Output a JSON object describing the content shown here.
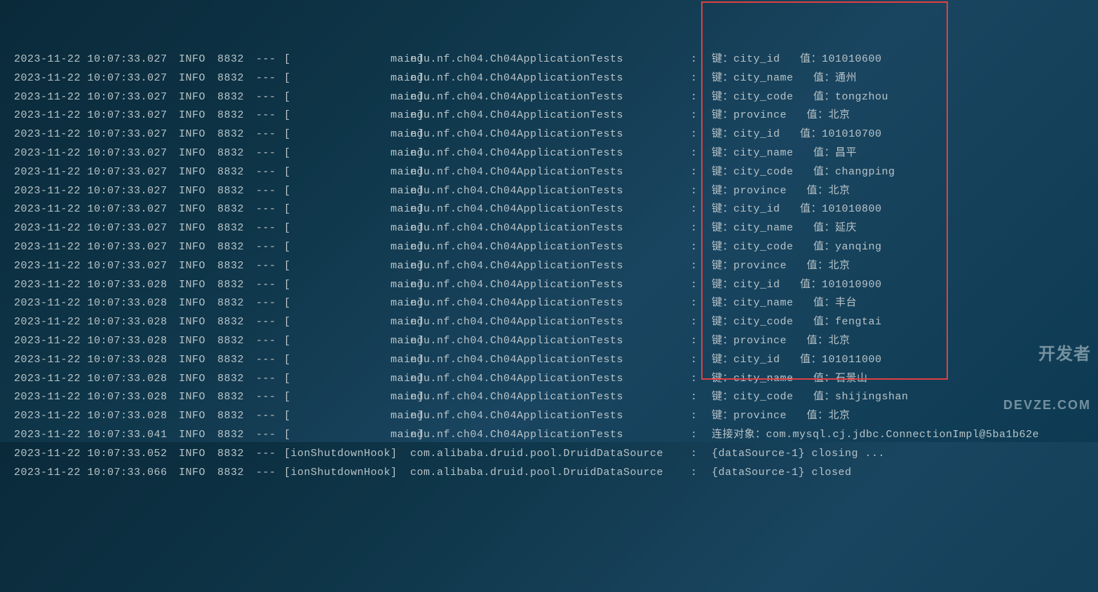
{
  "watermark": {
    "line1": "开发者",
    "line2": "DEVZE.COM"
  },
  "common": {
    "level": "INFO",
    "pid": "8832",
    "dashes": "---",
    "thread_main_fmt": "[               main]",
    "thread_shutdown_fmt": "[ionShutdownHook]",
    "logger_app": "edu.nf.ch04.Ch04ApplicationTests",
    "logger_druid": "com.alibaba.druid.pool.DruidDataSource",
    "colon": ":"
  },
  "lines": [
    {
      "ts": "2023-11-22 10:07:33.027",
      "thread": "main",
      "logger": "app",
      "msg": "键：city_id   值：101010600"
    },
    {
      "ts": "2023-11-22 10:07:33.027",
      "thread": "main",
      "logger": "app",
      "msg": "键：city_name   值：通州"
    },
    {
      "ts": "2023-11-22 10:07:33.027",
      "thread": "main",
      "logger": "app",
      "msg": "键：city_code   值：tongzhou"
    },
    {
      "ts": "2023-11-22 10:07:33.027",
      "thread": "main",
      "logger": "app",
      "msg": "键：province   值：北京"
    },
    {
      "ts": "2023-11-22 10:07:33.027",
      "thread": "main",
      "logger": "app",
      "msg": "键：city_id   值：101010700"
    },
    {
      "ts": "2023-11-22 10:07:33.027",
      "thread": "main",
      "logger": "app",
      "msg": "键：city_name   值：昌平"
    },
    {
      "ts": "2023-11-22 10:07:33.027",
      "thread": "main",
      "logger": "app",
      "msg": "键：city_code   值：changping"
    },
    {
      "ts": "2023-11-22 10:07:33.027",
      "thread": "main",
      "logger": "app",
      "msg": "键：province   值：北京"
    },
    {
      "ts": "2023-11-22 10:07:33.027",
      "thread": "main",
      "logger": "app",
      "msg": "键：city_id   值：101010800"
    },
    {
      "ts": "2023-11-22 10:07:33.027",
      "thread": "main",
      "logger": "app",
      "msg": "键：city_name   值：延庆"
    },
    {
      "ts": "2023-11-22 10:07:33.027",
      "thread": "main",
      "logger": "app",
      "msg": "键：city_code   值：yanqing"
    },
    {
      "ts": "2023-11-22 10:07:33.027",
      "thread": "main",
      "logger": "app",
      "msg": "键：province   值：北京"
    },
    {
      "ts": "2023-11-22 10:07:33.028",
      "thread": "main",
      "logger": "app",
      "msg": "键：city_id   值：101010900"
    },
    {
      "ts": "2023-11-22 10:07:33.028",
      "thread": "main",
      "logger": "app",
      "msg": "键：city_name   值：丰台"
    },
    {
      "ts": "2023-11-22 10:07:33.028",
      "thread": "main",
      "logger": "app",
      "msg": "键：city_code   值：fengtai"
    },
    {
      "ts": "2023-11-22 10:07:33.028",
      "thread": "main",
      "logger": "app",
      "msg": "键：province   值：北京"
    },
    {
      "ts": "2023-11-22 10:07:33.028",
      "thread": "main",
      "logger": "app",
      "msg": "键：city_id   值：101011000"
    },
    {
      "ts": "2023-11-22 10:07:33.028",
      "thread": "main",
      "logger": "app",
      "msg": "键：city_name   值：石景山"
    },
    {
      "ts": "2023-11-22 10:07:33.028",
      "thread": "main",
      "logger": "app",
      "msg": "键：city_code   值：shijingshan"
    },
    {
      "ts": "2023-11-22 10:07:33.028",
      "thread": "main",
      "logger": "app",
      "msg": "键：province   值：北京"
    },
    {
      "ts": "2023-11-22 10:07:33.041",
      "thread": "main",
      "logger": "app",
      "msg": "连接对象：com.mysql.cj.jdbc.ConnectionImpl@5ba1b62e"
    },
    {
      "ts": "2023-11-22 10:07:33.052",
      "thread": "shutdown",
      "logger": "druid",
      "msg": "{dataSource-1} closing ..."
    },
    {
      "ts": "2023-11-22 10:07:33.066",
      "thread": "shutdown",
      "logger": "druid",
      "msg": "{dataSource-1} closed"
    }
  ]
}
